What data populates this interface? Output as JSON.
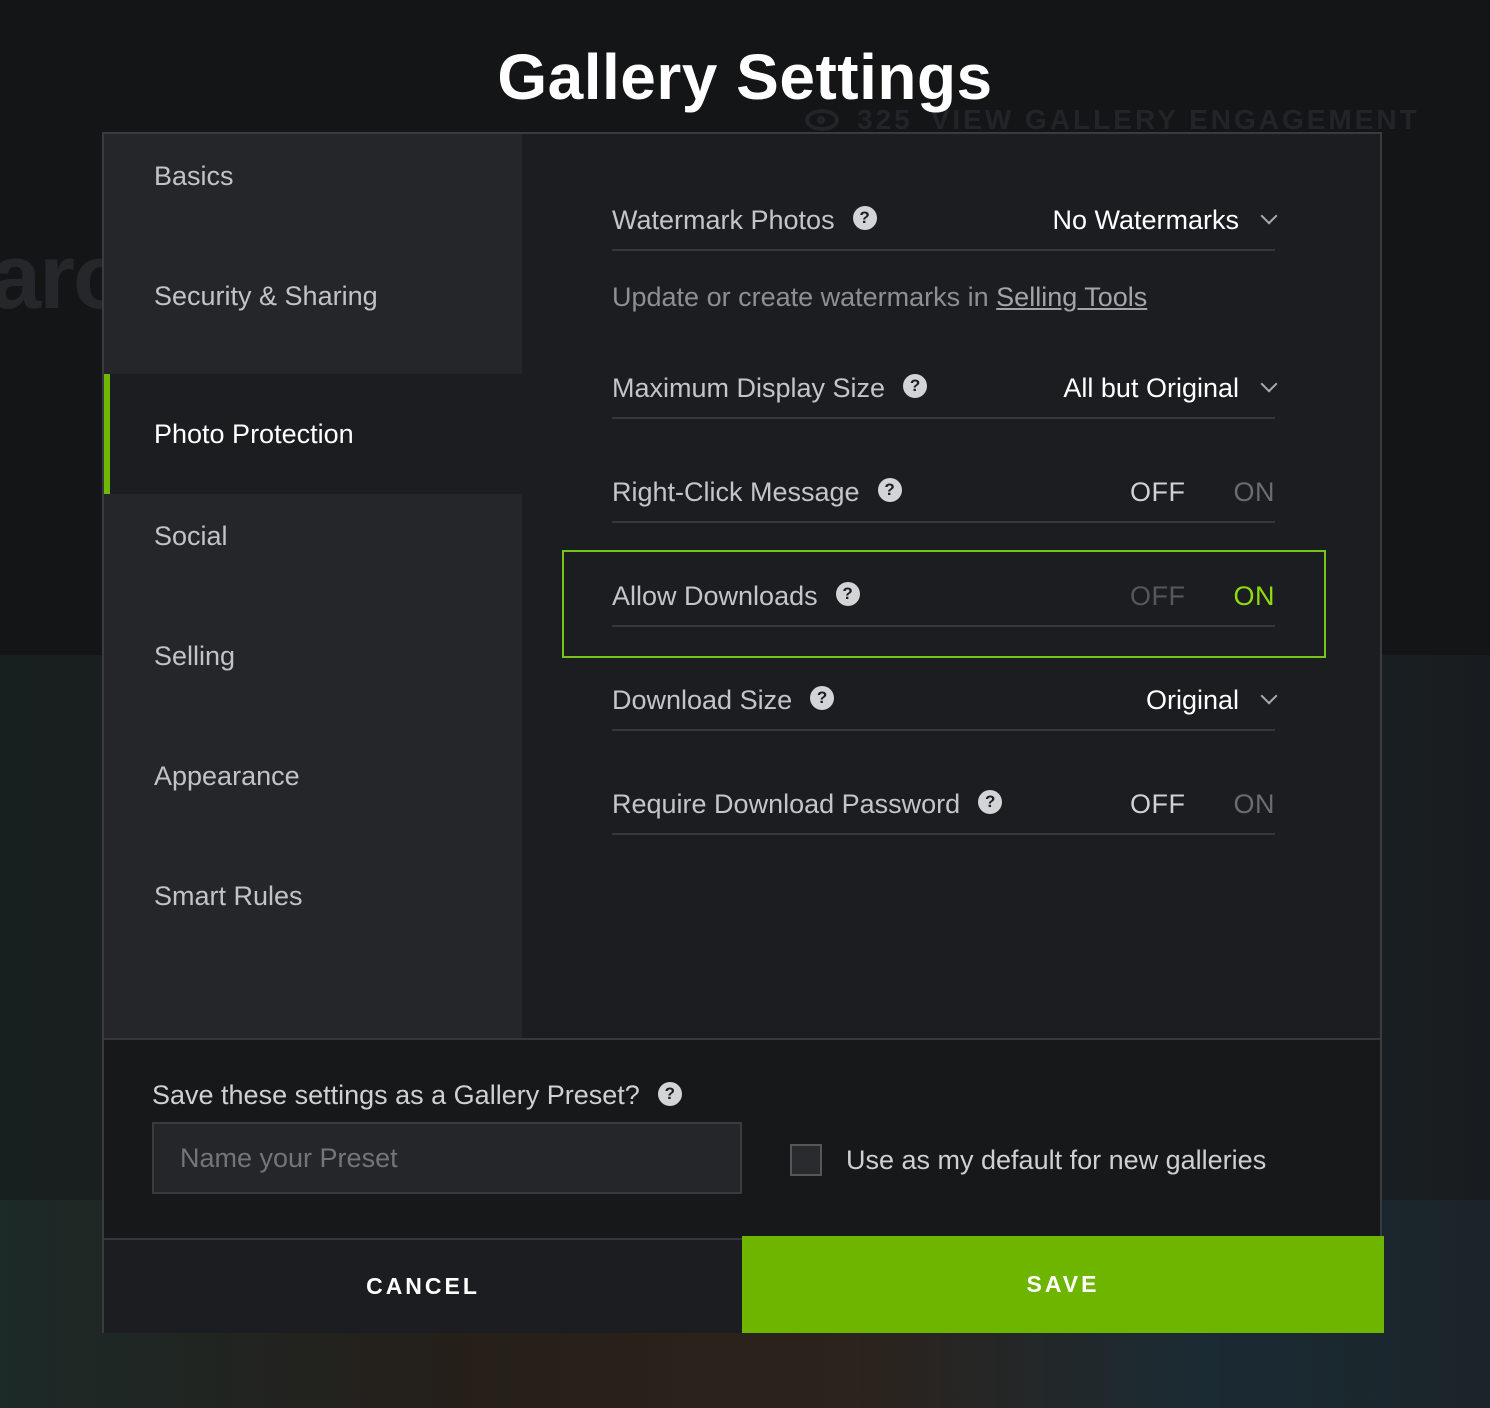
{
  "page": {
    "title": "Gallery Settings",
    "background": {
      "partial_text": "aro",
      "view_count": "325",
      "engagement_link": "VIEW GALLERY ENGAGEMENT"
    }
  },
  "sidebar": {
    "items": [
      {
        "label": "Basics",
        "active": false
      },
      {
        "label": "Security & Sharing",
        "active": false
      },
      {
        "label": "Photo Protection",
        "active": true
      },
      {
        "label": "Social",
        "active": false
      },
      {
        "label": "Selling",
        "active": false
      },
      {
        "label": "Appearance",
        "active": false
      },
      {
        "label": "Smart Rules",
        "active": false
      }
    ]
  },
  "settings": {
    "watermark": {
      "label": "Watermark Photos",
      "value": "No Watermarks"
    },
    "watermark_note": {
      "text": "Update or create watermarks in ",
      "link": "Selling Tools"
    },
    "display_size": {
      "label": "Maximum Display Size",
      "value": "All but Original"
    },
    "right_click": {
      "label": "Right-Click Message",
      "off": "OFF",
      "on": "ON",
      "state": "off"
    },
    "allow_downloads": {
      "label": "Allow Downloads",
      "off": "OFF",
      "on": "ON",
      "state": "on"
    },
    "download_size": {
      "label": "Download Size",
      "value": "Original"
    },
    "download_password": {
      "label": "Require Download Password",
      "off": "OFF",
      "on": "ON",
      "state": "off"
    },
    "help_glyph": "?"
  },
  "preset": {
    "label": "Save these settings as a Gallery Preset?",
    "input_placeholder": "Name your Preset",
    "input_value": "",
    "checkbox_label": "Use as my default for new galleries",
    "checkbox_checked": false
  },
  "footer": {
    "cancel_label": "CANCEL",
    "save_label": "SAVE"
  },
  "colors": {
    "accent": "#6eb500",
    "toggle_on": "#8fdc0e",
    "highlight_border": "#74c41a"
  }
}
